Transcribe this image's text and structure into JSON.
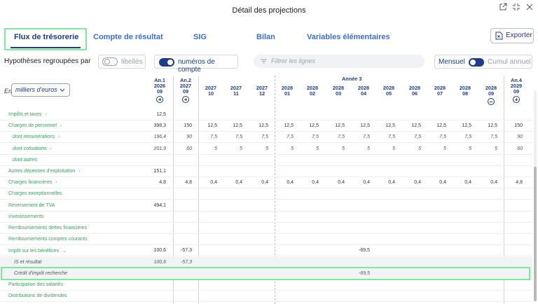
{
  "window": {
    "title": "Détail des projections"
  },
  "tabs": [
    {
      "label": "Flux de trésorerie",
      "active": true
    },
    {
      "label": "Compte de résultat"
    },
    {
      "label": "SIG"
    },
    {
      "label": "Bilan"
    },
    {
      "label": "Variables élémentaires"
    }
  ],
  "export": {
    "label": "Exporter"
  },
  "options": {
    "grouping_label": "Hypothèses regroupées par",
    "toggle_libelles": "libellés",
    "toggle_comptes": "numéros de compte",
    "filter_placeholder": "Filtrer les lignes",
    "mensuel": "Mensuel",
    "cumul": "Cumul annuel"
  },
  "unit": {
    "prefix": "En",
    "value": "milliers d'euros"
  },
  "columns": [
    {
      "year": "An.1",
      "top": "2026",
      "bottom": "09",
      "icon": "plus"
    },
    {
      "year": "An.2",
      "top": "2027",
      "bottom": "09",
      "icon": "plus"
    },
    {
      "year": "",
      "top": "2027",
      "bottom": "10"
    },
    {
      "year": "",
      "top": "2027",
      "bottom": "11"
    },
    {
      "year": "",
      "top": "2027",
      "bottom": "12"
    },
    {
      "year": "",
      "top": "2028",
      "bottom": "01"
    },
    {
      "year": "",
      "top": "2028",
      "bottom": "02"
    },
    {
      "year": "",
      "top": "2028",
      "bottom": "03"
    },
    {
      "year": "",
      "top": "2028",
      "bottom": "04"
    },
    {
      "year": "",
      "top": "2028",
      "bottom": "05"
    },
    {
      "year": "",
      "top": "2028",
      "bottom": "06"
    },
    {
      "year": "",
      "top": "2028",
      "bottom": "07"
    },
    {
      "year": "",
      "top": "2028",
      "bottom": "08"
    },
    {
      "year": "",
      "top": "2028",
      "bottom": "09",
      "icon": "minus"
    },
    {
      "year": "An.4",
      "top": "2029",
      "bottom": "09",
      "icon": "plus"
    }
  ],
  "annee3_label": "Année 3",
  "rows": [
    {
      "label": "Impôts et taxes",
      "chev": true,
      "values": [
        "12,5",
        "",
        "",
        "",
        "",
        "",
        "",
        "",
        "",
        "",
        "",
        "",
        "",
        "",
        ""
      ]
    },
    {
      "label": "Charges de personnel",
      "chev": true,
      "values": [
        "398,3",
        "150",
        "12,5",
        "12,5",
        "12,5",
        "12,5",
        "12,5",
        "12,5",
        "12,5",
        "12,5",
        "12,5",
        "12,5",
        "12,5",
        "12,5",
        "150"
      ]
    },
    {
      "label": "dont rémunérations",
      "chev": true,
      "sub": true,
      "italic": true,
      "values": [
        "196,4",
        "90",
        "7,5",
        "7,5",
        "7,5",
        "7,5",
        "7,5",
        "7,5",
        "7,5",
        "7,5",
        "7,5",
        "7,5",
        "7,5",
        "7,5",
        "90"
      ]
    },
    {
      "label": "dont cotisations",
      "chev": true,
      "sub": true,
      "italic": true,
      "values": [
        "201,9",
        "60",
        "5",
        "5",
        "5",
        "5",
        "5",
        "5",
        "5",
        "5",
        "5",
        "5",
        "5",
        "5",
        "60"
      ]
    },
    {
      "label": "dont autres",
      "sub": true,
      "italic": true,
      "values": [
        "",
        "",
        "",
        "",
        "",
        "",
        "",
        "",
        "",
        "",
        "",
        "",
        "",
        "",
        ""
      ]
    },
    {
      "label": "Autres dépenses d'exploitation",
      "chev": true,
      "values": [
        "151,1",
        "",
        "",
        "",
        "",
        "",
        "",
        "",
        "",
        "",
        "",
        "",
        "",
        "",
        ""
      ]
    },
    {
      "label": "Charges financières",
      "chev": true,
      "values": [
        "4,8",
        "4,8",
        "0,4",
        "0,4",
        "0,4",
        "0,4",
        "0,4",
        "0,4",
        "0,4",
        "0,4",
        "0,4",
        "0,4",
        "0,4",
        "0,4",
        "4,8"
      ]
    },
    {
      "label": "Charges exceptionnelles",
      "values": [
        "",
        "",
        "",
        "",
        "",
        "",
        "",
        "",
        "",
        "",
        "",
        "",
        "",
        "",
        ""
      ]
    },
    {
      "label": "Reversement de TVA",
      "values": [
        "494,1",
        "",
        "",
        "",
        "",
        "",
        "",
        "",
        "",
        "",
        "",
        "",
        "",
        "",
        ""
      ]
    },
    {
      "label": "Investissements",
      "values": [
        "",
        "",
        "",
        "",
        "",
        "",
        "",
        "",
        "",
        "",
        "",
        "",
        "",
        "",
        ""
      ]
    },
    {
      "label": "Remboursements dettes financières",
      "values": [
        "",
        "",
        "",
        "",
        "",
        "",
        "",
        "",
        "",
        "",
        "",
        "",
        "",
        "",
        ""
      ]
    },
    {
      "label": "Remboursements comptes courants",
      "values": [
        "",
        "",
        "",
        "",
        "",
        "",
        "",
        "",
        "",
        "",
        "",
        "",
        "",
        "",
        ""
      ]
    },
    {
      "label": "Impôt sur les bénéfices",
      "chev": "down",
      "values": [
        "100,6",
        "-57,3",
        "",
        "",
        "",
        "",
        "",
        "",
        "-69,5",
        "",
        "",
        "",
        "",
        "",
        ""
      ]
    },
    {
      "label": "IS et résultat",
      "dark": true,
      "shaded": true,
      "values": [
        "100,6",
        "-57,3",
        "",
        "",
        "",
        "",
        "",
        "",
        "",
        "",
        "",
        "",
        "",
        "",
        ""
      ]
    },
    {
      "label": "Crédit d'impôt recherche",
      "dark": true,
      "shaded": true,
      "highlight": true,
      "values": [
        "",
        "",
        "",
        "",
        "",
        "",
        "",
        "",
        "-69,5",
        "",
        "",
        "",
        "",
        "",
        ""
      ]
    },
    {
      "label": "Participation des salariés",
      "values": [
        "",
        "",
        "",
        "",
        "",
        "",
        "",
        "",
        "",
        "",
        "",
        "",
        "",
        "",
        ""
      ]
    },
    {
      "label": "Distributions de dividendes",
      "values": [
        "",
        "",
        "",
        "",
        "",
        "",
        "",
        "",
        "",
        "",
        "",
        "",
        "",
        "",
        ""
      ]
    }
  ]
}
